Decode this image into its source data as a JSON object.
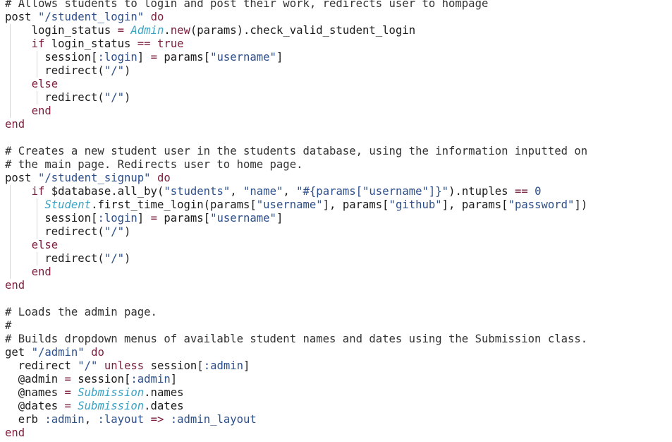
{
  "editor": {
    "lines": [
      {
        "indent_guides": [],
        "tokens": [
          {
            "t": "comment",
            "v": "# Allows students to login and post their work, redirects user to hompage"
          }
        ]
      },
      {
        "indent_guides": [],
        "tokens": [
          {
            "t": "plain",
            "v": "post "
          },
          {
            "t": "string",
            "v": "\"/student_login\""
          },
          {
            "t": "plain",
            "v": " "
          },
          {
            "t": "keyword",
            "v": "do"
          }
        ]
      },
      {
        "indent_guides": [
          1
        ],
        "tokens": [
          {
            "t": "plain",
            "v": "    login_status "
          },
          {
            "t": "op",
            "v": "="
          },
          {
            "t": "plain",
            "v": " "
          },
          {
            "t": "const",
            "v": "Admin"
          },
          {
            "t": "plain",
            "v": "."
          },
          {
            "t": "keyword",
            "v": "new"
          },
          {
            "t": "plain",
            "v": "(params).check_valid_student_login"
          }
        ]
      },
      {
        "indent_guides": [
          1
        ],
        "tokens": [
          {
            "t": "plain",
            "v": "    "
          },
          {
            "t": "keyword",
            "v": "if"
          },
          {
            "t": "plain",
            "v": " login_status "
          },
          {
            "t": "op",
            "v": "=="
          },
          {
            "t": "plain",
            "v": " "
          },
          {
            "t": "keyword",
            "v": "true"
          }
        ]
      },
      {
        "indent_guides": [
          1,
          2
        ],
        "tokens": [
          {
            "t": "plain",
            "v": "      session["
          },
          {
            "t": "symbol",
            "v": ":login"
          },
          {
            "t": "plain",
            "v": "] "
          },
          {
            "t": "op",
            "v": "="
          },
          {
            "t": "plain",
            "v": " params["
          },
          {
            "t": "string",
            "v": "\"username\""
          },
          {
            "t": "plain",
            "v": "]"
          }
        ]
      },
      {
        "indent_guides": [
          1,
          2
        ],
        "tokens": [
          {
            "t": "plain",
            "v": "      redirect("
          },
          {
            "t": "string",
            "v": "\"/\""
          },
          {
            "t": "plain",
            "v": ")"
          }
        ]
      },
      {
        "indent_guides": [
          1
        ],
        "tokens": [
          {
            "t": "plain",
            "v": "    "
          },
          {
            "t": "keyword",
            "v": "else"
          }
        ]
      },
      {
        "indent_guides": [
          1,
          2
        ],
        "tokens": [
          {
            "t": "plain",
            "v": "      redirect("
          },
          {
            "t": "string",
            "v": "\"/\""
          },
          {
            "t": "plain",
            "v": ")"
          }
        ]
      },
      {
        "indent_guides": [
          1
        ],
        "tokens": [
          {
            "t": "plain",
            "v": "    "
          },
          {
            "t": "keyword",
            "v": "end"
          }
        ]
      },
      {
        "indent_guides": [],
        "tokens": [
          {
            "t": "keyword",
            "v": "end"
          }
        ]
      },
      {
        "indent_guides": [],
        "tokens": []
      },
      {
        "indent_guides": [],
        "tokens": [
          {
            "t": "comment",
            "v": "# Creates a new student user in the students database, using the information inputted on"
          }
        ]
      },
      {
        "indent_guides": [],
        "tokens": [
          {
            "t": "comment",
            "v": "# the main page. Redirects user to home page."
          }
        ]
      },
      {
        "indent_guides": [],
        "tokens": [
          {
            "t": "plain",
            "v": "post "
          },
          {
            "t": "string",
            "v": "\"/student_signup\""
          },
          {
            "t": "plain",
            "v": " "
          },
          {
            "t": "keyword",
            "v": "do"
          }
        ]
      },
      {
        "indent_guides": [
          1
        ],
        "tokens": [
          {
            "t": "plain",
            "v": "    "
          },
          {
            "t": "keyword",
            "v": "if"
          },
          {
            "t": "plain",
            "v": " $database.all_by("
          },
          {
            "t": "string",
            "v": "\"students\""
          },
          {
            "t": "plain",
            "v": ", "
          },
          {
            "t": "string",
            "v": "\"name\""
          },
          {
            "t": "plain",
            "v": ", "
          },
          {
            "t": "string",
            "v": "\"#{params[\"username\"]}\""
          },
          {
            "t": "plain",
            "v": ").ntuples "
          },
          {
            "t": "op",
            "v": "=="
          },
          {
            "t": "plain",
            "v": " "
          },
          {
            "t": "number",
            "v": "0"
          }
        ]
      },
      {
        "indent_guides": [
          1,
          2
        ],
        "tokens": [
          {
            "t": "plain",
            "v": "      "
          },
          {
            "t": "const",
            "v": "Student"
          },
          {
            "t": "plain",
            "v": ".first_time_login(params["
          },
          {
            "t": "string",
            "v": "\"username\""
          },
          {
            "t": "plain",
            "v": "], params["
          },
          {
            "t": "string",
            "v": "\"github\""
          },
          {
            "t": "plain",
            "v": "], params["
          },
          {
            "t": "string",
            "v": "\"password\""
          },
          {
            "t": "plain",
            "v": "])"
          }
        ]
      },
      {
        "indent_guides": [
          1,
          2
        ],
        "tokens": [
          {
            "t": "plain",
            "v": "      session["
          },
          {
            "t": "symbol",
            "v": ":login"
          },
          {
            "t": "plain",
            "v": "] "
          },
          {
            "t": "op",
            "v": "="
          },
          {
            "t": "plain",
            "v": " params["
          },
          {
            "t": "string",
            "v": "\"username\""
          },
          {
            "t": "plain",
            "v": "]"
          }
        ]
      },
      {
        "indent_guides": [
          1,
          2
        ],
        "tokens": [
          {
            "t": "plain",
            "v": "      redirect("
          },
          {
            "t": "string",
            "v": "\"/\""
          },
          {
            "t": "plain",
            "v": ")"
          }
        ]
      },
      {
        "indent_guides": [
          1
        ],
        "tokens": [
          {
            "t": "plain",
            "v": "    "
          },
          {
            "t": "keyword",
            "v": "else"
          }
        ]
      },
      {
        "indent_guides": [
          1,
          2
        ],
        "tokens": [
          {
            "t": "plain",
            "v": "      redirect("
          },
          {
            "t": "string",
            "v": "\"/\""
          },
          {
            "t": "plain",
            "v": ")"
          }
        ]
      },
      {
        "indent_guides": [
          1
        ],
        "tokens": [
          {
            "t": "plain",
            "v": "    "
          },
          {
            "t": "keyword",
            "v": "end"
          }
        ]
      },
      {
        "indent_guides": [],
        "tokens": [
          {
            "t": "keyword",
            "v": "end"
          }
        ]
      },
      {
        "indent_guides": [],
        "tokens": []
      },
      {
        "indent_guides": [],
        "tokens": [
          {
            "t": "comment",
            "v": "# Loads the admin page."
          }
        ]
      },
      {
        "indent_guides": [],
        "tokens": [
          {
            "t": "comment",
            "v": "#"
          }
        ]
      },
      {
        "indent_guides": [],
        "tokens": [
          {
            "t": "comment",
            "v": "# Builds dropdown menus of available student names and dates using the Submission class."
          }
        ]
      },
      {
        "indent_guides": [],
        "tokens": [
          {
            "t": "plain",
            "v": "get "
          },
          {
            "t": "string",
            "v": "\"/admin\""
          },
          {
            "t": "plain",
            "v": " "
          },
          {
            "t": "keyword",
            "v": "do"
          }
        ]
      },
      {
        "indent_guides": [],
        "tokens": [
          {
            "t": "plain",
            "v": "  redirect "
          },
          {
            "t": "string",
            "v": "\"/\""
          },
          {
            "t": "plain",
            "v": " "
          },
          {
            "t": "keyword",
            "v": "unless"
          },
          {
            "t": "plain",
            "v": " session["
          },
          {
            "t": "symbol",
            "v": ":admin"
          },
          {
            "t": "plain",
            "v": "]"
          }
        ]
      },
      {
        "indent_guides": [],
        "tokens": [
          {
            "t": "plain",
            "v": "  @admin "
          },
          {
            "t": "op",
            "v": "="
          },
          {
            "t": "plain",
            "v": " session["
          },
          {
            "t": "symbol",
            "v": ":admin"
          },
          {
            "t": "plain",
            "v": "]"
          }
        ]
      },
      {
        "indent_guides": [],
        "tokens": [
          {
            "t": "plain",
            "v": "  @names "
          },
          {
            "t": "op",
            "v": "="
          },
          {
            "t": "plain",
            "v": " "
          },
          {
            "t": "const",
            "v": "Submission"
          },
          {
            "t": "plain",
            "v": ".names"
          }
        ]
      },
      {
        "indent_guides": [],
        "tokens": [
          {
            "t": "plain",
            "v": "  @dates "
          },
          {
            "t": "op",
            "v": "="
          },
          {
            "t": "plain",
            "v": " "
          },
          {
            "t": "const",
            "v": "Submission"
          },
          {
            "t": "plain",
            "v": ".dates"
          }
        ]
      },
      {
        "indent_guides": [],
        "tokens": [
          {
            "t": "plain",
            "v": "  erb "
          },
          {
            "t": "symbol",
            "v": ":admin"
          },
          {
            "t": "plain",
            "v": ", "
          },
          {
            "t": "symbol",
            "v": ":layout"
          },
          {
            "t": "plain",
            "v": " "
          },
          {
            "t": "op",
            "v": "=>"
          },
          {
            "t": "plain",
            "v": " "
          },
          {
            "t": "symbol",
            "v": ":admin_layout"
          }
        ]
      },
      {
        "indent_guides": [],
        "tokens": [
          {
            "t": "keyword",
            "v": "end"
          }
        ]
      }
    ]
  }
}
